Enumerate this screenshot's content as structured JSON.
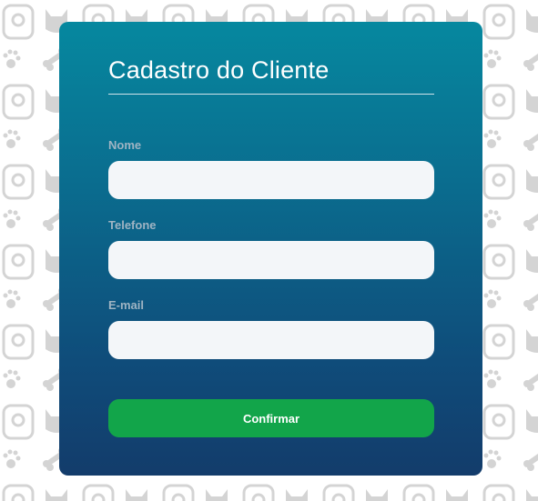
{
  "form": {
    "title": "Cadastro do Cliente",
    "fields": [
      {
        "label": "Nome",
        "value": "",
        "placeholder": ""
      },
      {
        "label": "Telefone",
        "value": "",
        "placeholder": ""
      },
      {
        "label": "E-mail",
        "value": "",
        "placeholder": ""
      }
    ],
    "confirm_label": "Confirmar"
  },
  "background": {
    "pattern_icons": [
      "dog-icon",
      "cat-icon",
      "paw-icon",
      "bone-icon",
      "doghouse-icon",
      "food-bowl-icon"
    ],
    "pattern_color": "#d4d4d4"
  },
  "colors": {
    "card_top": "#06889f",
    "card_bottom": "#133c6b",
    "button": "#12a54a",
    "input_bg": "#f3f6f9",
    "label": "#9fb4c3"
  }
}
